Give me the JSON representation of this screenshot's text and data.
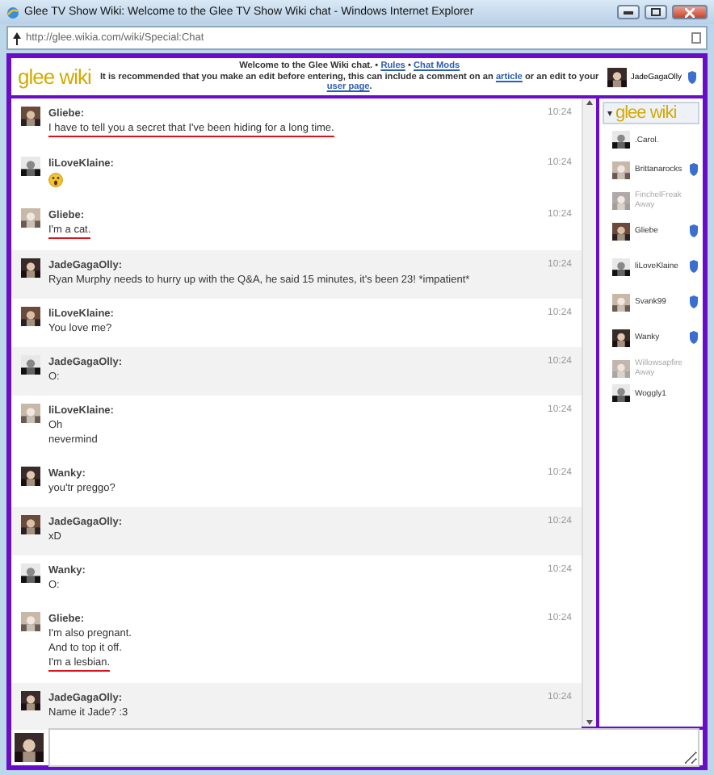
{
  "window": {
    "title": "Glee TV Show Wiki: Welcome to the Glee TV Show Wiki chat - Windows Internet Explorer",
    "address": "http://glee.wikia.com/wiki/Special:Chat"
  },
  "header": {
    "logo": "glee wiki",
    "welcome": "Welcome to the Glee Wiki chat.",
    "sep": "•",
    "links": [
      "Rules",
      "Chat Mods"
    ],
    "notice": "It is recommended that you make an edit before entering, this can include a comment on an",
    "notice_link": "article",
    "notice_mid": "or an edit to your",
    "notice_link2": "user page",
    "notice_end": ".",
    "user": {
      "name": "JadeGagaOlly",
      "mod": true
    }
  },
  "messages": [
    {
      "user": "Gliebe:",
      "time": "10:24",
      "shaded": false,
      "lines": [
        {
          "kind": "text",
          "text": "I have to tell you a secret that I've been hiding for a long time.",
          "underlined": true
        }
      ]
    },
    {
      "user": "liLoveKlaine:",
      "time": "10:24",
      "shaded": false,
      "lines": [
        {
          "kind": "emoji"
        }
      ]
    },
    {
      "user": "Gliebe:",
      "time": "10:24",
      "shaded": false,
      "lines": [
        {
          "kind": "text",
          "text": "I'm a cat.",
          "underlined": true
        }
      ]
    },
    {
      "user": "JadeGagaOlly:",
      "time": "10:24",
      "shaded": true,
      "lines": [
        {
          "kind": "text",
          "text": "Ryan Murphy needs to hurry up with the Q&A, he said 15 minutes, it's been 23! *impatient*",
          "underlined": false
        }
      ]
    },
    {
      "user": "liLoveKlaine:",
      "time": "10:24",
      "shaded": false,
      "lines": [
        {
          "kind": "text",
          "text": "You love me?",
          "underlined": false
        }
      ]
    },
    {
      "user": "JadeGagaOlly:",
      "time": "10:24",
      "shaded": true,
      "lines": [
        {
          "kind": "text",
          "text": "O:",
          "underlined": false
        }
      ]
    },
    {
      "user": "liLoveKlaine:",
      "time": "10:24",
      "shaded": false,
      "lines": [
        {
          "kind": "text",
          "text": "Oh",
          "underlined": false
        },
        {
          "kind": "text",
          "text": "nevermind",
          "underlined": false
        }
      ]
    },
    {
      "user": "Wanky:",
      "time": "10:24",
      "shaded": false,
      "lines": [
        {
          "kind": "text",
          "text": "you'tr preggo?",
          "underlined": false
        }
      ]
    },
    {
      "user": "JadeGagaOlly:",
      "time": "10:24",
      "shaded": true,
      "lines": [
        {
          "kind": "text",
          "text": "xD",
          "underlined": false
        }
      ]
    },
    {
      "user": "Wanky:",
      "time": "10:24",
      "shaded": false,
      "lines": [
        {
          "kind": "text",
          "text": "O:",
          "underlined": false
        }
      ]
    },
    {
      "user": "Gliebe:",
      "time": "10:24",
      "shaded": false,
      "lines": [
        {
          "kind": "text",
          "text": "I'm also pregnant.",
          "underlined": false
        },
        {
          "kind": "text",
          "text": "And to top it off.",
          "underlined": false
        },
        {
          "kind": "text",
          "text": "I'm a lesbian.",
          "underlined": true
        }
      ]
    },
    {
      "user": "JadeGagaOlly:",
      "time": "10:24",
      "shaded": true,
      "lines": [
        {
          "kind": "text",
          "text": "Name it Jade? :3",
          "underlined": false
        }
      ]
    }
  ],
  "sidebar": {
    "logo": "glee wiki",
    "caret": "▾",
    "users": [
      {
        "name": ".Carol.",
        "away": false,
        "mod": false
      },
      {
        "name": "Brittanarocks",
        "away": false,
        "mod": true
      },
      {
        "name": "FinchelFreak",
        "away": true,
        "status": "Away",
        "mod": false
      },
      {
        "name": "Gliebe",
        "away": false,
        "mod": true
      },
      {
        "name": "liLoveKlaine",
        "away": false,
        "mod": true
      },
      {
        "name": "Svank99",
        "away": false,
        "mod": true
      },
      {
        "name": "Wanky",
        "away": false,
        "mod": true
      },
      {
        "name": "Willowsapfire",
        "away": true,
        "status": "Away",
        "mod": false
      },
      {
        "name": "Woggly1",
        "away": false,
        "mod": false
      }
    ]
  }
}
